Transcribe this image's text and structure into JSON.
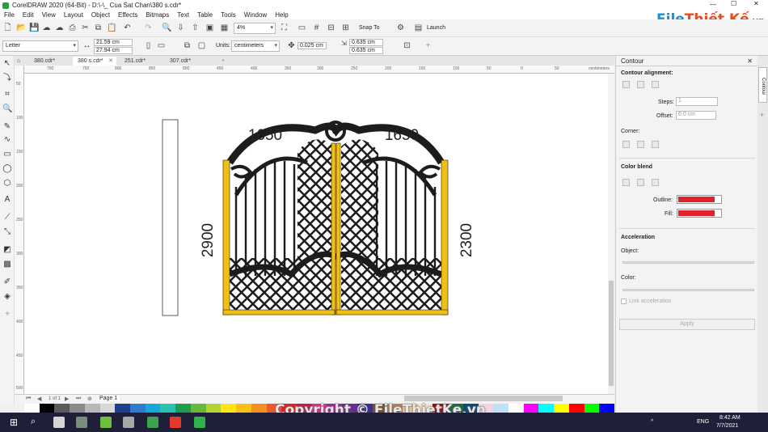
{
  "window": {
    "title": "CorelDRAW 2020 (64-Bit) - D:\\-\\_ Cua Sat Chan\\380 s.cdr*"
  },
  "menu": [
    "File",
    "Edit",
    "View",
    "Layout",
    "Object",
    "Effects",
    "Bitmaps",
    "Text",
    "Table",
    "Tools",
    "Window",
    "Help"
  ],
  "toolbar": {
    "zoom": "4%",
    "snap_to": "Snap To",
    "launch": "Launch"
  },
  "propertybar": {
    "page_size": "Letter",
    "width": "21.59 cm",
    "height": "27.94 cm",
    "units_label": "Units:",
    "units": "centimeters",
    "nudge": "0.025 cm",
    "dup_x": "0.635 cm",
    "dup_y": "0.635 cm"
  },
  "tabs": [
    {
      "label": "380.cdr*",
      "active": false
    },
    {
      "label": "380 s.cdr*",
      "active": true
    },
    {
      "label": "251.cdr*",
      "active": false
    },
    {
      "label": "307.cdr*",
      "active": false
    }
  ],
  "ruler": {
    "h_labels": [
      "700",
      "750",
      "800",
      "850",
      "800",
      "450",
      "400",
      "350",
      "300",
      "250",
      "200",
      "150",
      "100",
      "50",
      "0",
      "50"
    ],
    "unit": "centimeters",
    "v_labels": [
      "50",
      "100",
      "150",
      "200",
      "250",
      "300",
      "350",
      "400",
      "450",
      "500"
    ]
  },
  "drawing": {
    "left_width": "1650",
    "right_width": "1650",
    "left_height": "2900",
    "right_height": "2300",
    "post_color": "#f2c012"
  },
  "pagenav": {
    "page_info": "1 of 1",
    "page_tab": "Page 1"
  },
  "docker": {
    "title": "Contour",
    "tab_label": "Contour",
    "contour_alignment": "Contour alignment:",
    "steps_label": "Steps:",
    "steps_value": "1",
    "offset_label": "Offset:",
    "offset_value": "6.0 cm",
    "corner": "Corner:",
    "color_blend": "Color blend",
    "outline_label": "Outline:",
    "fill_label": "Fill:",
    "outline_color": "#e0212b",
    "fill_color": "#e0212b",
    "acceleration": "Acceleration",
    "object_label": "Object:",
    "color_label": "Color:",
    "link_accel": "Link acceleration",
    "apply": "Apply"
  },
  "palette": [
    "#ffffff",
    "#000000",
    "#5a5a5a",
    "#8a8a8a",
    "#b8b8b8",
    "#d8d8d8",
    "#1d3f8e",
    "#2e7bcf",
    "#1aa6d9",
    "#2cc1b0",
    "#1d9e48",
    "#67b83b",
    "#b4d332",
    "#ffe417",
    "#fcbf17",
    "#f49121",
    "#ef5a27",
    "#e42026",
    "#c21c4a",
    "#e52d8a",
    "#a3278f",
    "#6a2c91",
    "#3b2f8f",
    "#7f4f24",
    "#b7835b",
    "#e1c29b",
    "#f7e3c5",
    "#9e0b0f",
    "#1f6c3f",
    "#0e4a7a",
    "#f3d3e0",
    "#c2e0f4",
    "#ffffff",
    "#ff00ff",
    "#00ffff",
    "#ffff00",
    "#ff0000",
    "#00ff00",
    "#0000ff"
  ],
  "taskbar": {
    "lang": "ENG",
    "time": "8:42 AM",
    "date": "7/7/2021"
  },
  "watermark": "Copyright © FileThietKe.vn",
  "brand": {
    "part1": "File",
    "part2": "Thiết Kế",
    "suffix": ".vn"
  }
}
